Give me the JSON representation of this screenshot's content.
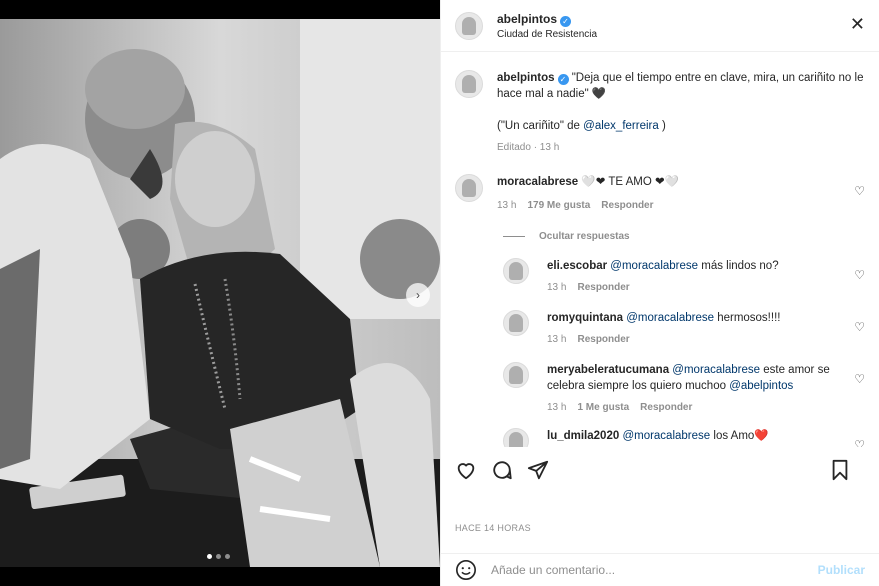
{
  "header": {
    "username": "abelpintos",
    "location": "Ciudad de Resistencia"
  },
  "caption": {
    "username": "abelpintos",
    "text": "\"Deja que el tiempo entre en clave, mira, un cariñito no le hace mal a nadie\" 🖤",
    "credit_prefix": "(\"Un cariñito\" de ",
    "credit_mention": "@alex_ferreira",
    "credit_suffix": " )",
    "edited": "Editado · 13 h"
  },
  "comment": {
    "username": "moracalabrese",
    "text": "🤍❤ TE AMO ❤🤍",
    "time": "13 h",
    "likes": "179 Me gusta",
    "reply_label": "Responder"
  },
  "hide_replies": "Ocultar respuestas",
  "replies": [
    {
      "username": "eli.escobar",
      "mention": "@moracalabrese",
      "text": " más lindos no?",
      "time": "13 h",
      "likes": "",
      "reply_label": "Responder"
    },
    {
      "username": "romyquintana",
      "mention": "@moracalabrese",
      "text": " hermosos!!!!",
      "time": "13 h",
      "likes": "",
      "reply_label": "Responder"
    },
    {
      "username": "meryabeleratucumana",
      "mention": "@moracalabrese",
      "text": " este amor se celebra siempre los quiero muchoo ",
      "mention2": "@abelpintos",
      "time": "13 h",
      "likes": "1 Me gusta",
      "reply_label": "Responder"
    },
    {
      "username": "lu_dmila2020",
      "mention": "@moracalabrese",
      "text": " los Amo❤️",
      "time": "",
      "likes": "",
      "reply_label": ""
    }
  ],
  "time_ago": "HACE 14 HORAS",
  "add_comment": {
    "placeholder": "Añade un comentario...",
    "post_label": "Publicar"
  },
  "carousel": {
    "total": 3,
    "active": 1
  },
  "colors": {
    "link": "#00376b",
    "muted": "#8e8e8e",
    "post_disabled": "#b2dffc",
    "verified": "#3897f0"
  }
}
